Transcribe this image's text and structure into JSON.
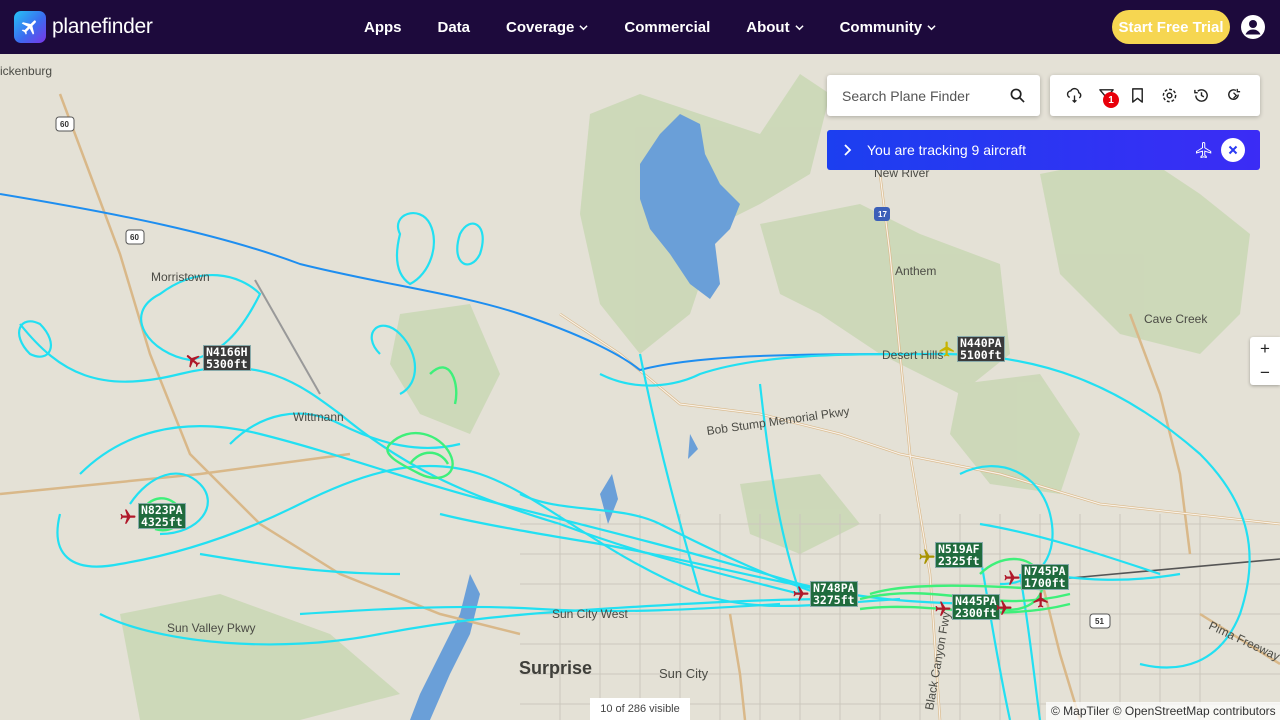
{
  "header": {
    "logo_text": "planefinder",
    "nav": [
      {
        "label": "Apps",
        "dropdown": false
      },
      {
        "label": "Data",
        "dropdown": false
      },
      {
        "label": "Coverage",
        "dropdown": true
      },
      {
        "label": "Commercial",
        "dropdown": false
      },
      {
        "label": "About",
        "dropdown": true
      },
      {
        "label": "Community",
        "dropdown": true
      }
    ],
    "trial_button": "Start Free Trial"
  },
  "search": {
    "placeholder": "Search Plane Finder"
  },
  "toolbar": {
    "icons": [
      "weather-icon",
      "filter-icon",
      "bookmark-icon",
      "settings-icon",
      "history-icon",
      "playback-icon"
    ],
    "filter_badge": "1"
  },
  "tracking": {
    "text": "You are tracking 9 aircraft"
  },
  "zoom": {
    "in": "+",
    "out": "−"
  },
  "map": {
    "places": [
      {
        "name": "ickenburg",
        "big": false
      },
      {
        "name": "Morristown",
        "big": false
      },
      {
        "name": "Wittmann",
        "big": false
      },
      {
        "name": "New River",
        "big": false
      },
      {
        "name": "Anthem",
        "big": false
      },
      {
        "name": "Cave Creek",
        "big": false
      },
      {
        "name": "Desert Hills",
        "big": false
      },
      {
        "name": "Bob Stump Memorial Pkwy",
        "big": false
      },
      {
        "name": "Sun Valley Pkwy",
        "big": false
      },
      {
        "name": "Surprise",
        "big": true
      },
      {
        "name": "Sun City",
        "big": false
      },
      {
        "name": "Sun City West",
        "big": false
      },
      {
        "name": "Pima Freeway",
        "big": false
      },
      {
        "name": "Black Canyon Fwy",
        "big": false
      }
    ],
    "shields": [
      "60",
      "60",
      "17",
      "51"
    ]
  },
  "aircraft": [
    {
      "callsign": "N4166H",
      "altitude": "5300ft",
      "green": false
    },
    {
      "callsign": "N440PA",
      "altitude": "5100ft",
      "green": false
    },
    {
      "callsign": "N823PA",
      "altitude": "4325ft",
      "green": true
    },
    {
      "callsign": "N519AF",
      "altitude": "2325ft",
      "green": true
    },
    {
      "callsign": "N748PA",
      "altitude": "3275ft",
      "green": true
    },
    {
      "callsign": "N745PA",
      "altitude": "1700ft",
      "green": true
    },
    {
      "callsign": "N445PA",
      "altitude": "2300ft",
      "green": true
    }
  ],
  "footer": {
    "visible_count": "10 of 286 visible",
    "attribution": "© MapTiler © OpenStreetMap contributors"
  },
  "colors": {
    "header_bg": "#1d0a3c",
    "trial_button": "#f6d651",
    "tracking_bar": "#1c3ff0",
    "track_cyan": "#22e0f2",
    "track_green": "#3ef07a",
    "track_blue": "#1e8ef0",
    "water": "#6a9fd8",
    "badge": "#e8000b"
  }
}
